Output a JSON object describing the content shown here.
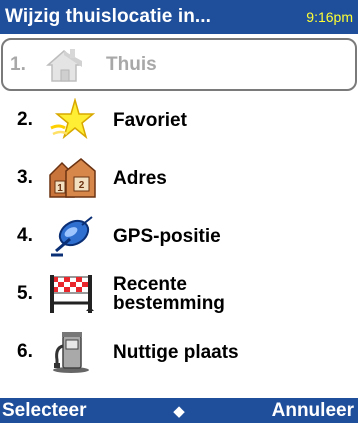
{
  "header": {
    "title": "Wijzig thuislocatie in...",
    "time": "9:16pm"
  },
  "menu": {
    "items": [
      {
        "number": "1.",
        "label": "Thuis",
        "icon": "house-icon",
        "selected": true
      },
      {
        "number": "2.",
        "label": "Favoriet",
        "icon": "star-icon",
        "selected": false
      },
      {
        "number": "3.",
        "label": "Adres",
        "icon": "address-houses-icon",
        "selected": false
      },
      {
        "number": "4.",
        "label": "GPS-positie",
        "icon": "gps-satellite-icon",
        "selected": false
      },
      {
        "number": "5.",
        "label": "Recente\nbestemming",
        "icon": "finish-banner-icon",
        "selected": false
      },
      {
        "number": "6.",
        "label": "Nuttige plaats",
        "icon": "gas-pump-icon",
        "selected": false
      }
    ]
  },
  "softkeys": {
    "left": "Selecteer",
    "center": "◆",
    "right": "Annuleer"
  },
  "colors": {
    "bar_background": "#1f4f9b",
    "time_color": "#ffff33",
    "selected_border": "#7a7a7a",
    "disabled_text": "#a8a8a8"
  }
}
